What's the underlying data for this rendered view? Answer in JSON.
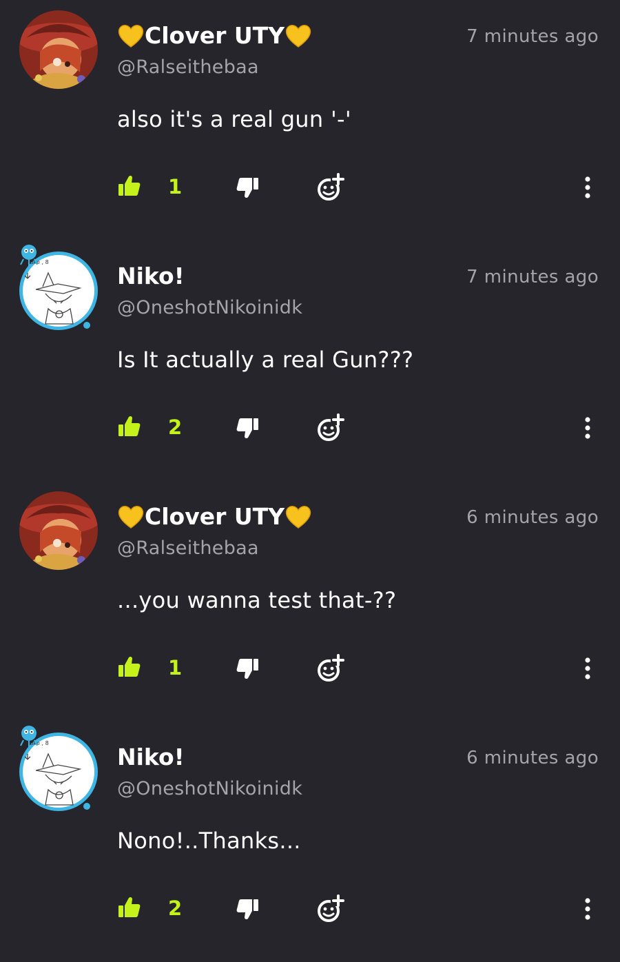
{
  "comments": [
    {
      "author": "Clover UTY",
      "handle": "@Ralseithebaa",
      "time": "7 minutes ago",
      "text": "also it's a real gun '-'",
      "likes": "1",
      "avatar": "clover"
    },
    {
      "author": "Niko!",
      "handle": "@OneshotNikoinidk",
      "time": "7 minutes ago",
      "text": "Is It actually a real Gun???",
      "likes": "2",
      "avatar": "niko"
    },
    {
      "author": "Clover UTY",
      "handle": "@Ralseithebaa",
      "time": "6 minutes ago",
      "text": "...you wanna test that-??",
      "likes": "1",
      "avatar": "clover"
    },
    {
      "author": "Niko!",
      "handle": "@OneshotNikoinidk",
      "time": "6 minutes ago",
      "text": "Nono!..Thanks...",
      "likes": "2",
      "avatar": "niko"
    }
  ],
  "avatar_caption": "Like , 8",
  "colors": {
    "background": "#26252c",
    "like_accent": "#c6f21b",
    "muted_text": "#a5a4ab",
    "heart_emoji": "#f7c21d",
    "niko_ring": "#3fb5e3"
  },
  "icons": {
    "like": "thumbs-up-icon",
    "dislike": "thumbs-down-icon",
    "react": "add-reaction-icon",
    "more": "more-vertical-icon",
    "name_decoration": "yellow-heart-icon"
  }
}
